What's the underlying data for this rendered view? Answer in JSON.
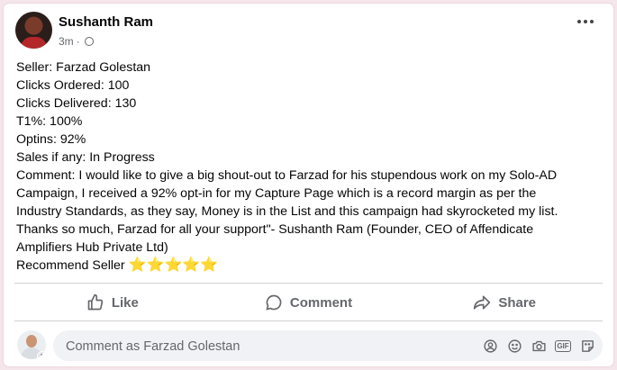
{
  "post": {
    "author": "Sushanth Ram",
    "time": "3m",
    "separator": "·",
    "lines": [
      "Seller: Farzad Golestan",
      "Clicks Ordered: 100",
      "Clicks Delivered: 130",
      "T1%: 100%",
      "Optins: 92%",
      "Sales if any: In Progress",
      "Comment: I would like to give a big shout-out to Farzad for his stupendous work on my Solo-AD",
      "Campaign, I received a 92% opt-in for my Capture Page which is a record margin as per the",
      "Industry Standards, as they say, Money is in the List and this campaign had skyrocketed my list.",
      "Thanks so much, Farzad for all your support\"- Sushanth Ram (Founder, CEO of Affendicate",
      "Amplifiers Hub Private Ltd)"
    ],
    "recommend": "Recommend Seller",
    "stars": "⭐⭐⭐⭐⭐"
  },
  "actions": {
    "like": "Like",
    "comment": "Comment",
    "share": "Share"
  },
  "comment_box": {
    "placeholder": "Comment as Farzad Golestan"
  },
  "icons": {
    "privacy": "globe-icon",
    "menu": "more-options-icon",
    "like": "thumbs-up-icon",
    "comment": "speech-bubble-icon",
    "share": "share-arrow-icon",
    "tools": [
      "avatar-sticker-icon",
      "emoji-icon",
      "camera-icon",
      "gif-icon",
      "sticker-icon"
    ]
  },
  "colors": {
    "text": "#050505",
    "secondary": "#65676b",
    "stars": "#f5b400",
    "page_background": "#f4e6ea"
  }
}
